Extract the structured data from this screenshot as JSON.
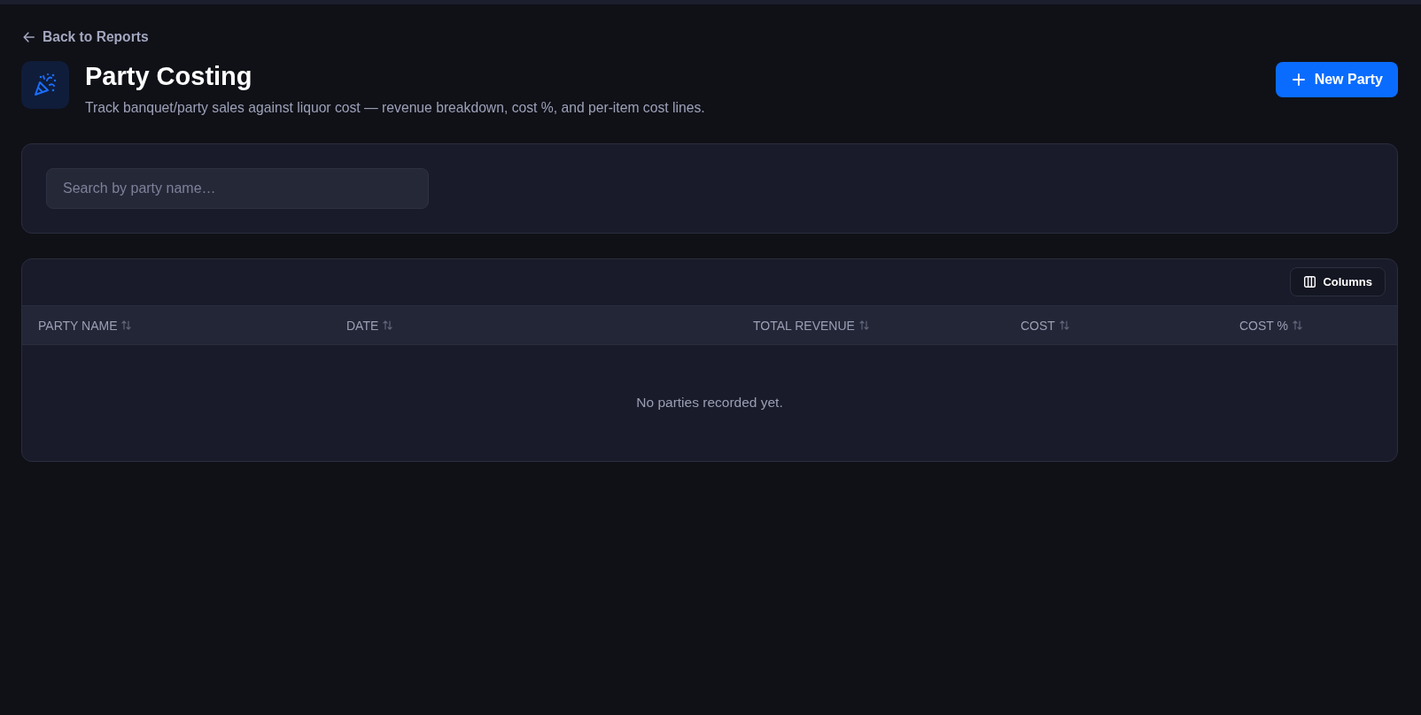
{
  "back_link": {
    "label": "Back to Reports"
  },
  "header": {
    "title": "Party Costing",
    "subtitle": "Track banquet/party sales against liquor cost — revenue breakdown, cost %, and per-item cost lines.",
    "action_button": {
      "label": "New Party"
    }
  },
  "search": {
    "placeholder": "Search by party name…"
  },
  "table": {
    "columns_button": {
      "label": "Columns"
    },
    "columns": [
      {
        "label": "PARTY NAME",
        "sortable": true
      },
      {
        "label": "DATE",
        "sortable": true
      },
      {
        "label": "TOTAL REVENUE",
        "sortable": true
      },
      {
        "label": "COST",
        "sortable": true
      },
      {
        "label": "COST %",
        "sortable": true
      }
    ],
    "empty_message": "No parties recorded yet."
  }
}
